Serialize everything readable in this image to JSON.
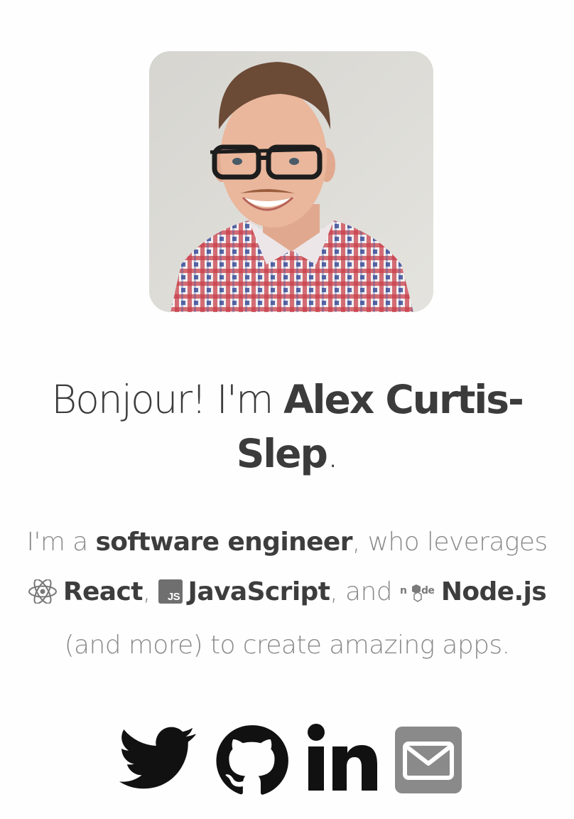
{
  "profile": {
    "photo_alt": "Alex Curtis-Slep"
  },
  "greeting": {
    "prefix": "Bonjour! I'm ",
    "name_part1": "Alex Curtis-",
    "name_part2": "Slep",
    "suffix": "."
  },
  "intro": {
    "lead": "I'm a ",
    "role": "software engineer",
    "after_role": ", who leverages",
    "tech": [
      {
        "name": "React",
        "icon": "react-icon"
      },
      {
        "name": "JavaScript",
        "icon": "javascript-icon"
      },
      {
        "name": "Node.js",
        "icon": "nodejs-icon"
      }
    ],
    "sep1": ", ",
    "sep2": ", and ",
    "closing": "(and more) to create amazing apps."
  },
  "socials": [
    {
      "name": "Twitter",
      "icon": "twitter-icon"
    },
    {
      "name": "GitHub",
      "icon": "github-icon"
    },
    {
      "name": "LinkedIn",
      "icon": "linkedin-icon"
    },
    {
      "name": "Email",
      "icon": "email-icon"
    }
  ],
  "colors": {
    "heading": "#3b3b3b",
    "body_muted": "#8a8a8a",
    "icon": "#111111",
    "email_icon": "#8a8a8a"
  }
}
